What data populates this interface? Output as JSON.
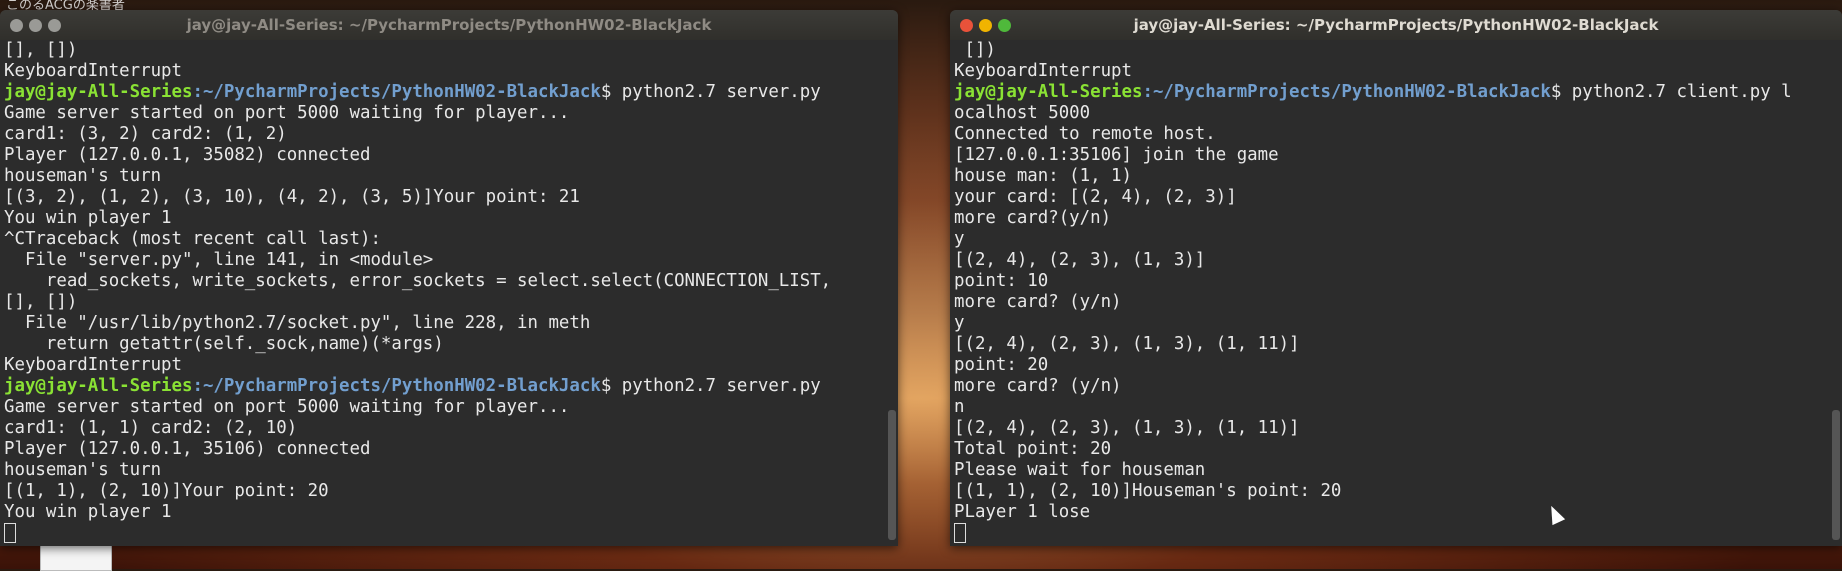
{
  "desktop": {
    "top_text": "このるACGの楽書者"
  },
  "left_window": {
    "title": "jay@jay-All-Series: ~/PycharmProjects/PythonHW02-BlackJack",
    "lines": [
      {
        "text": "[], [])"
      },
      {
        "text": "KeyboardInterrupt"
      },
      {
        "user": "jay@jay-All-Series",
        "path": ":~/PycharmProjects/PythonHW02-BlackJack",
        "cmd": "$ python2.7 server.py"
      },
      {
        "text": "Game server started on port 5000 waiting for player..."
      },
      {
        "text": "card1: (3, 2) card2: (1, 2)"
      },
      {
        "text": "Player (127.0.0.1, 35082) connected"
      },
      {
        "text": "houseman's turn"
      },
      {
        "text": "[(3, 2), (1, 2), (3, 10), (4, 2), (3, 5)]Your point: 21"
      },
      {
        "text": "You win player 1"
      },
      {
        "text": "^CTraceback (most recent call last):"
      },
      {
        "text": "  File \"server.py\", line 141, in <module>"
      },
      {
        "text": "    read_sockets, write_sockets, error_sockets = select.select(CONNECTION_LIST,"
      },
      {
        "text": "[], [])"
      },
      {
        "text": "  File \"/usr/lib/python2.7/socket.py\", line 228, in meth"
      },
      {
        "text": "    return getattr(self._sock,name)(*args)"
      },
      {
        "text": "KeyboardInterrupt"
      },
      {
        "user": "jay@jay-All-Series",
        "path": ":~/PycharmProjects/PythonHW02-BlackJack",
        "cmd": "$ python2.7 server.py"
      },
      {
        "text": "Game server started on port 5000 waiting for player..."
      },
      {
        "text": "card1: (1, 1) card2: (2, 10)"
      },
      {
        "text": "Player (127.0.0.1, 35106) connected"
      },
      {
        "text": "houseman's turn"
      },
      {
        "text": "[(1, 1), (2, 10)]Your point: 20"
      },
      {
        "text": "You win player 1"
      }
    ]
  },
  "right_window": {
    "title": "jay@jay-All-Series: ~/PycharmProjects/PythonHW02-BlackJack",
    "lines": [
      {
        "text": " [])"
      },
      {
        "text": "KeyboardInterrupt"
      },
      {
        "user": "jay@jay-All-Series",
        "path": ":~/PycharmProjects/PythonHW02-BlackJack",
        "cmd": "$ python2.7 client.py l"
      },
      {
        "text": "ocalhost 5000"
      },
      {
        "text": "Connected to remote host."
      },
      {
        "text": "[127.0.0.1:35106] join the game"
      },
      {
        "text": "house man: (1, 1)"
      },
      {
        "text": "your card: [(2, 4), (2, 3)]"
      },
      {
        "text": "more card?(y/n)"
      },
      {
        "text": "y"
      },
      {
        "text": "[(2, 4), (2, 3), (1, 3)]"
      },
      {
        "text": "point: 10"
      },
      {
        "text": "more card? (y/n)"
      },
      {
        "text": "y"
      },
      {
        "text": "[(2, 4), (2, 3), (1, 3), (1, 11)]"
      },
      {
        "text": "point: 20"
      },
      {
        "text": "more card? (y/n)"
      },
      {
        "text": "n"
      },
      {
        "text": "[(2, 4), (2, 3), (1, 3), (1, 11)]"
      },
      {
        "text": "Total point: 20"
      },
      {
        "text": "Please wait for houseman"
      },
      {
        "text": "[(1, 1), (2, 10)]Houseman's point: 20"
      },
      {
        "text": "PLayer 1 lose"
      }
    ]
  },
  "colors": {
    "prompt_user": "#8ae234",
    "prompt_path": "#729fcf",
    "terminal_bg": "#2c2c2c",
    "terminal_fg": "#e8e8e8"
  }
}
